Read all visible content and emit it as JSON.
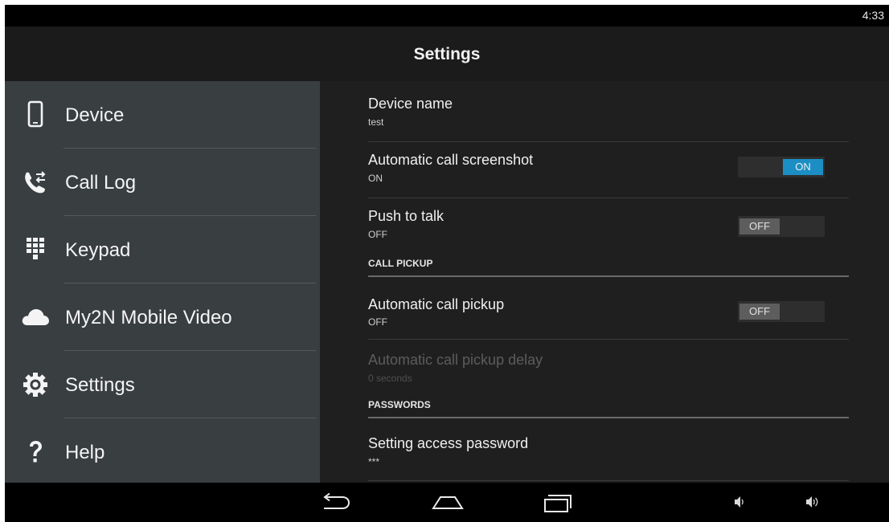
{
  "status": {
    "time": "4:33"
  },
  "action_bar": {
    "title": "Settings"
  },
  "sidebar": {
    "items": [
      {
        "label": "Device",
        "icon": "phone-icon"
      },
      {
        "label": "Call Log",
        "icon": "call-log-icon"
      },
      {
        "label": "Keypad",
        "icon": "keypad-icon"
      },
      {
        "label": "My2N Mobile Video",
        "icon": "cloud-icon"
      },
      {
        "label": "Settings",
        "icon": "gear-icon"
      },
      {
        "label": "Help",
        "icon": "question-icon"
      }
    ]
  },
  "preferences": {
    "device_name": {
      "title": "Device name",
      "summary": "test"
    },
    "auto_screenshot": {
      "title": "Automatic call screenshot",
      "summary": "ON",
      "toggle": "ON"
    },
    "push_to_talk": {
      "title": "Push to talk",
      "summary": "OFF",
      "toggle": "OFF"
    },
    "category_call_pickup": "CALL PICKUP",
    "auto_pickup": {
      "title": "Automatic call pickup",
      "summary": "OFF",
      "toggle": "OFF"
    },
    "auto_pickup_delay": {
      "title": "Automatic call pickup delay",
      "summary": "0 seconds"
    },
    "category_passwords": "PASSWORDS",
    "access_password": {
      "title": "Setting access password",
      "summary": "***"
    }
  },
  "colors": {
    "accent": "#1b8fc3",
    "sidebar_bg": "#393e41",
    "content_bg": "#1f1f1f"
  },
  "navbar": {
    "buttons": [
      "back-icon",
      "home-icon",
      "recents-icon",
      "volume-down-icon",
      "volume-up-icon"
    ]
  }
}
